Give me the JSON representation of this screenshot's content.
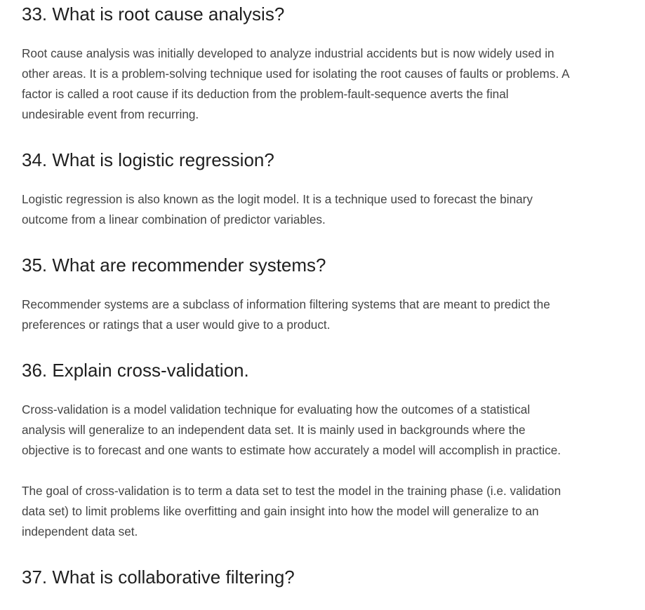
{
  "questions": [
    {
      "title": "33. What is root cause analysis?",
      "paragraphs": [
        "Root cause analysis was initially developed to analyze industrial accidents but is now widely used in other areas. It is a problem-solving technique used for isolating the root causes of faults or problems. A factor is called a root cause if its deduction from the problem-fault-sequence averts the final undesirable event from recurring."
      ]
    },
    {
      "title": "34. What is logistic regression?",
      "paragraphs": [
        "Logistic regression is also known as the logit model. It is a technique used to forecast the binary outcome from a linear combination of predictor variables."
      ]
    },
    {
      "title": "35. What are recommender systems?",
      "paragraphs": [
        "Recommender systems are a subclass of information filtering systems that are meant to predict the preferences or ratings that a user would give to a product."
      ]
    },
    {
      "title": "36. Explain cross-validation.",
      "paragraphs": [
        "Cross-validation is a model validation technique for evaluating how the outcomes of a statistical analysis will generalize to an independent data set. It is mainly used in backgrounds where the objective is to forecast and one wants to estimate how accurately a model will accomplish in practice.",
        "The goal of cross-validation is to term a data set to test the model in the training phase (i.e. validation data set) to limit problems like overfitting and gain insight into how the model will generalize to an independent data set."
      ]
    },
    {
      "title": "37. What is collaborative filtering?",
      "paragraphs": []
    }
  ]
}
